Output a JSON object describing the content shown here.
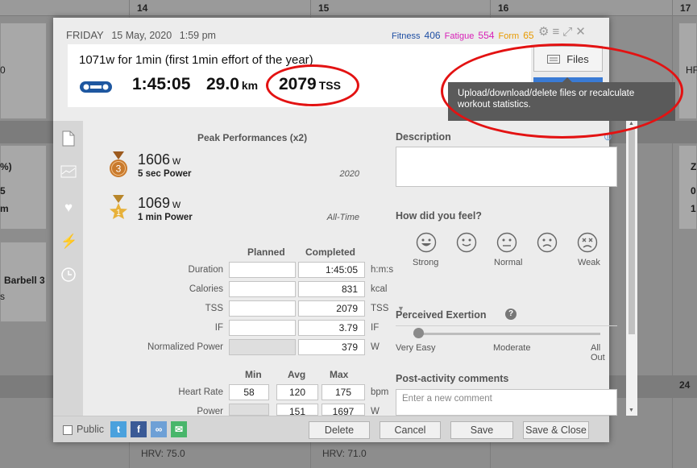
{
  "calendar": {
    "day_numbers": [
      "14",
      "15",
      "16",
      "17",
      "24"
    ],
    "bg_text": [
      "0",
      "%)",
      "5",
      "m",
      "Barbell 3",
      "s",
      "HF",
      "Z",
      "0",
      "1",
      "HRV: 75.0",
      "HRV: 71.0"
    ]
  },
  "header": {
    "weekday": "FRIDAY",
    "date": "15 May, 2020",
    "time": "1:59 pm",
    "fitness_label": "Fitness",
    "fitness_value": "406",
    "fatigue_label": "Fatigue",
    "fatigue_value": "554",
    "form_label": "Form",
    "form_value": "65"
  },
  "summary": {
    "title": "1071w for 1min (first 1min effort of the year)",
    "duration": "1:45:05",
    "distance": "29.0",
    "distance_unit": "km",
    "tss": "2079",
    "tss_unit": "TSS"
  },
  "files_button": {
    "label": "Files"
  },
  "tooltip": {
    "text": "Upload/download/delete files or recalculate workout statistics."
  },
  "peak": {
    "title": "Peak Performances (x2)",
    "items": [
      {
        "rank": "3",
        "value": "1606",
        "unit": "w",
        "label": "5 sec Power",
        "period": "2020",
        "medal_color": "#c97a2c"
      },
      {
        "rank": "1",
        "value": "1069",
        "unit": "w",
        "label": "1 min Power",
        "period": "All-Time",
        "medal_color": "#e7b13a"
      }
    ]
  },
  "planned_completed": {
    "headers": [
      "Planned",
      "Completed"
    ],
    "rows": [
      {
        "label": "Duration",
        "planned": "",
        "completed": "1:45:05",
        "unit": "h:m:s"
      },
      {
        "label": "Calories",
        "planned": "",
        "completed": "831",
        "unit": "kcal"
      },
      {
        "label": "TSS",
        "planned": "",
        "completed": "2079",
        "unit": "TSS"
      },
      {
        "label": "IF",
        "planned": "",
        "completed": "3.79",
        "unit": "IF"
      },
      {
        "label": "Normalized Power",
        "planned": "",
        "completed": "379",
        "unit": "W"
      }
    ]
  },
  "min_avg_max": {
    "headers": [
      "Min",
      "Avg",
      "Max"
    ],
    "rows": [
      {
        "label": "Heart Rate",
        "min": "58",
        "avg": "120",
        "max": "175",
        "unit": "bpm"
      },
      {
        "label": "Power",
        "min": "",
        "avg": "151",
        "max": "1697",
        "unit": "W"
      }
    ]
  },
  "description": {
    "title": "Description"
  },
  "feel": {
    "title": "How did you feel?",
    "labels": [
      "Strong",
      "Normal",
      "Weak"
    ]
  },
  "exertion": {
    "title": "Perceived Exertion",
    "labels": [
      "Very Easy",
      "Moderate",
      "All Out"
    ],
    "value": 0
  },
  "comments": {
    "title": "Post-activity comments",
    "placeholder": "Enter a new comment"
  },
  "footer": {
    "public_label": "Public",
    "buttons": [
      "Delete",
      "Cancel",
      "Save",
      "Save & Close"
    ]
  },
  "colors": {
    "annotation": "#e31212",
    "twitter": "#4aa1dd",
    "facebook": "#3b5a96",
    "link": "#6ea0d6",
    "email": "#49b66b"
  }
}
